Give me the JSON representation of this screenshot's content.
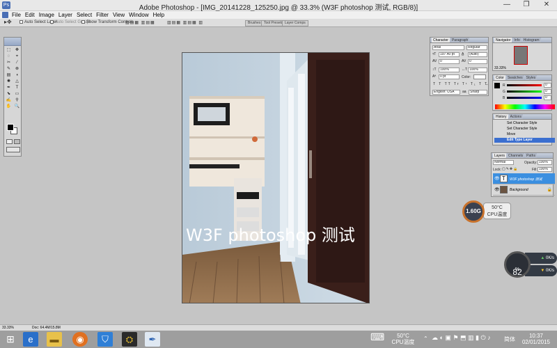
{
  "window": {
    "title": "Adobe Photoshop - [IMG_20141228_125250.jpg @ 33.3% (W3F photoshop 测试, RGB/8)]",
    "minimize": "—",
    "restore": "❐",
    "close": "✕"
  },
  "menu": [
    "File",
    "Edit",
    "Image",
    "Layer",
    "Select",
    "Filter",
    "View",
    "Window",
    "Help"
  ],
  "options": {
    "auto_select_layer": "Auto Select Layer",
    "auto_select_groups": "Auto Select Groups",
    "show_transform_controls": "Show Transform Controls",
    "palette_tabs": [
      "Brushes",
      "Tool Presets",
      "Layer Comps"
    ]
  },
  "toolbox": {
    "tools": [
      "⬚",
      "✥",
      "◌",
      "⌖",
      "✂",
      "⁄",
      "✎",
      "⊗",
      "▤",
      "◖",
      "✺",
      "△",
      "✒",
      "T",
      "⬊",
      "▭",
      "✍",
      "⚲",
      "✋",
      "🔍"
    ]
  },
  "canvas": {
    "overlay_text": "W3F photoshop 测试"
  },
  "panels": {
    "character": {
      "tabs": [
        "Character",
        "Paragraph"
      ],
      "font_family": "Arial",
      "font_style": "Regular",
      "font_size": "197.40 pt",
      "leading": "(Auto)",
      "kerning": "0",
      "tracking": "0",
      "vertical_scale": "100%",
      "horizontal_scale": "100%",
      "baseline_shift": "0 pt",
      "color_label": "Color:",
      "style_buttons": [
        "T",
        "T",
        "TT",
        "Tr",
        "T¹",
        "T₁",
        "T",
        "T̶"
      ],
      "language": "English: USA",
      "antialias": "Sharp",
      "antialias_prefix": "aa"
    },
    "navigator": {
      "tabs": [
        "Navigator",
        "Info",
        "Histogram"
      ],
      "zoom": "33.33%"
    },
    "color": {
      "tabs": [
        "Color",
        "Swatches",
        "Styles"
      ],
      "channels": [
        {
          "label": "R",
          "value": "0"
        },
        {
          "label": "G",
          "value": "0"
        },
        {
          "label": "B",
          "value": "0"
        }
      ]
    },
    "history": {
      "tabs": [
        "History",
        "Actions"
      ],
      "items": [
        "Set Character Style",
        "Set Character Style",
        "Move",
        "Edit Type Layer"
      ]
    },
    "layers": {
      "tabs": [
        "Layers",
        "Channels",
        "Paths"
      ],
      "blend_mode": "Normal",
      "opacity_label": "Opacity:",
      "opacity": "100%",
      "lock_label": "Lock:",
      "fill_label": "Fill:",
      "fill": "100%",
      "layers": [
        {
          "name": "W3F photoshop 测试",
          "thumb": "T"
        },
        {
          "name": "Background",
          "thumb": ""
        }
      ]
    }
  },
  "status": {
    "zoom": "33.33%",
    "doc": "Doc: 64.4M/15.8M"
  },
  "gadgets": {
    "cpu_ring_value": "1.60G",
    "cpu_temp": "50°C",
    "cpu_label": "CPU温度",
    "net_percent": "82",
    "net_percent_unit": "%",
    "upload": "0K/s",
    "download": "0K/s"
  },
  "taskbar": {
    "tray_temp": "50°C",
    "tray_temp_label": "CPU温度",
    "ime": "简体",
    "time": "10:37",
    "date": "02/01/2015",
    "up_arrow": "⌃"
  },
  "colors": {
    "accent": "#3b8fe0",
    "history_selected": "#3b6fd0",
    "cpu_ring": "#c8722c"
  }
}
